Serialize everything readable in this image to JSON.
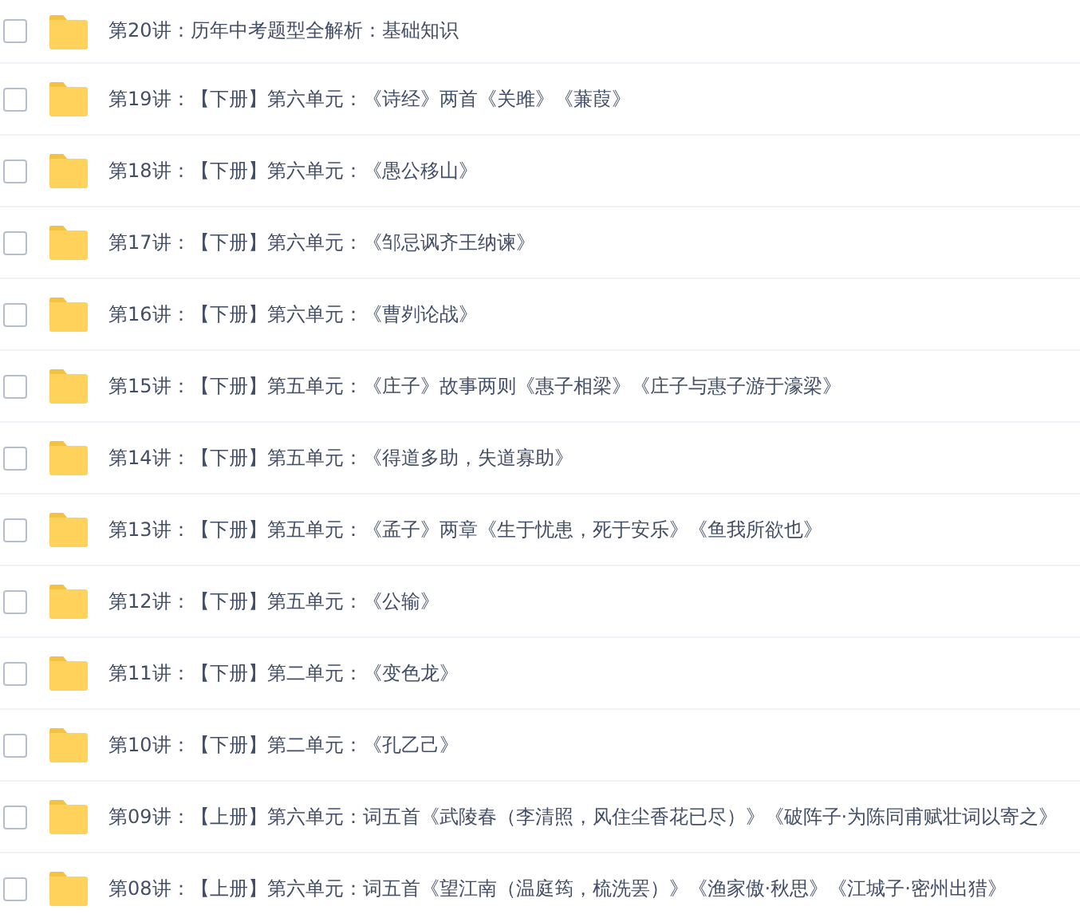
{
  "files": [
    {
      "name": "第20讲：历年中考题型全解析：基础知识",
      "checked": false
    },
    {
      "name": "第19讲：【下册】第六单元：《诗经》两首《关雎》《蒹葭》",
      "checked": false
    },
    {
      "name": "第18讲：【下册】第六单元：《愚公移山》",
      "checked": false
    },
    {
      "name": "第17讲：【下册】第六单元：《邹忌讽齐王纳谏》",
      "checked": false
    },
    {
      "name": "第16讲：【下册】第六单元：《曹刿论战》",
      "checked": false
    },
    {
      "name": "第15讲：【下册】第五单元：《庄子》故事两则《惠子相梁》《庄子与惠子游于濠梁》",
      "checked": false
    },
    {
      "name": "第14讲：【下册】第五单元：《得道多助，失道寡助》",
      "checked": false
    },
    {
      "name": "第13讲：【下册】第五单元：《孟子》两章《生于忧患，死于安乐》《鱼我所欲也》",
      "checked": false
    },
    {
      "name": "第12讲：【下册】第五单元：《公输》",
      "checked": false
    },
    {
      "name": "第11讲：【下册】第二单元：《变色龙》",
      "checked": false
    },
    {
      "name": "第10讲：【下册】第二单元：《孔乙己》",
      "checked": false
    },
    {
      "name": "第09讲：【上册】第六单元：词五首《武陵春（李清照，风住尘香花已尽）》《破阵子·为陈同甫赋壮词以寄之》",
      "checked": false
    },
    {
      "name": "第08讲：【上册】第六单元：词五首《望江南（温庭筠，梳洗罢）》《渔家傲·秋思》《江城子·密州出猎》",
      "checked": false
    }
  ]
}
